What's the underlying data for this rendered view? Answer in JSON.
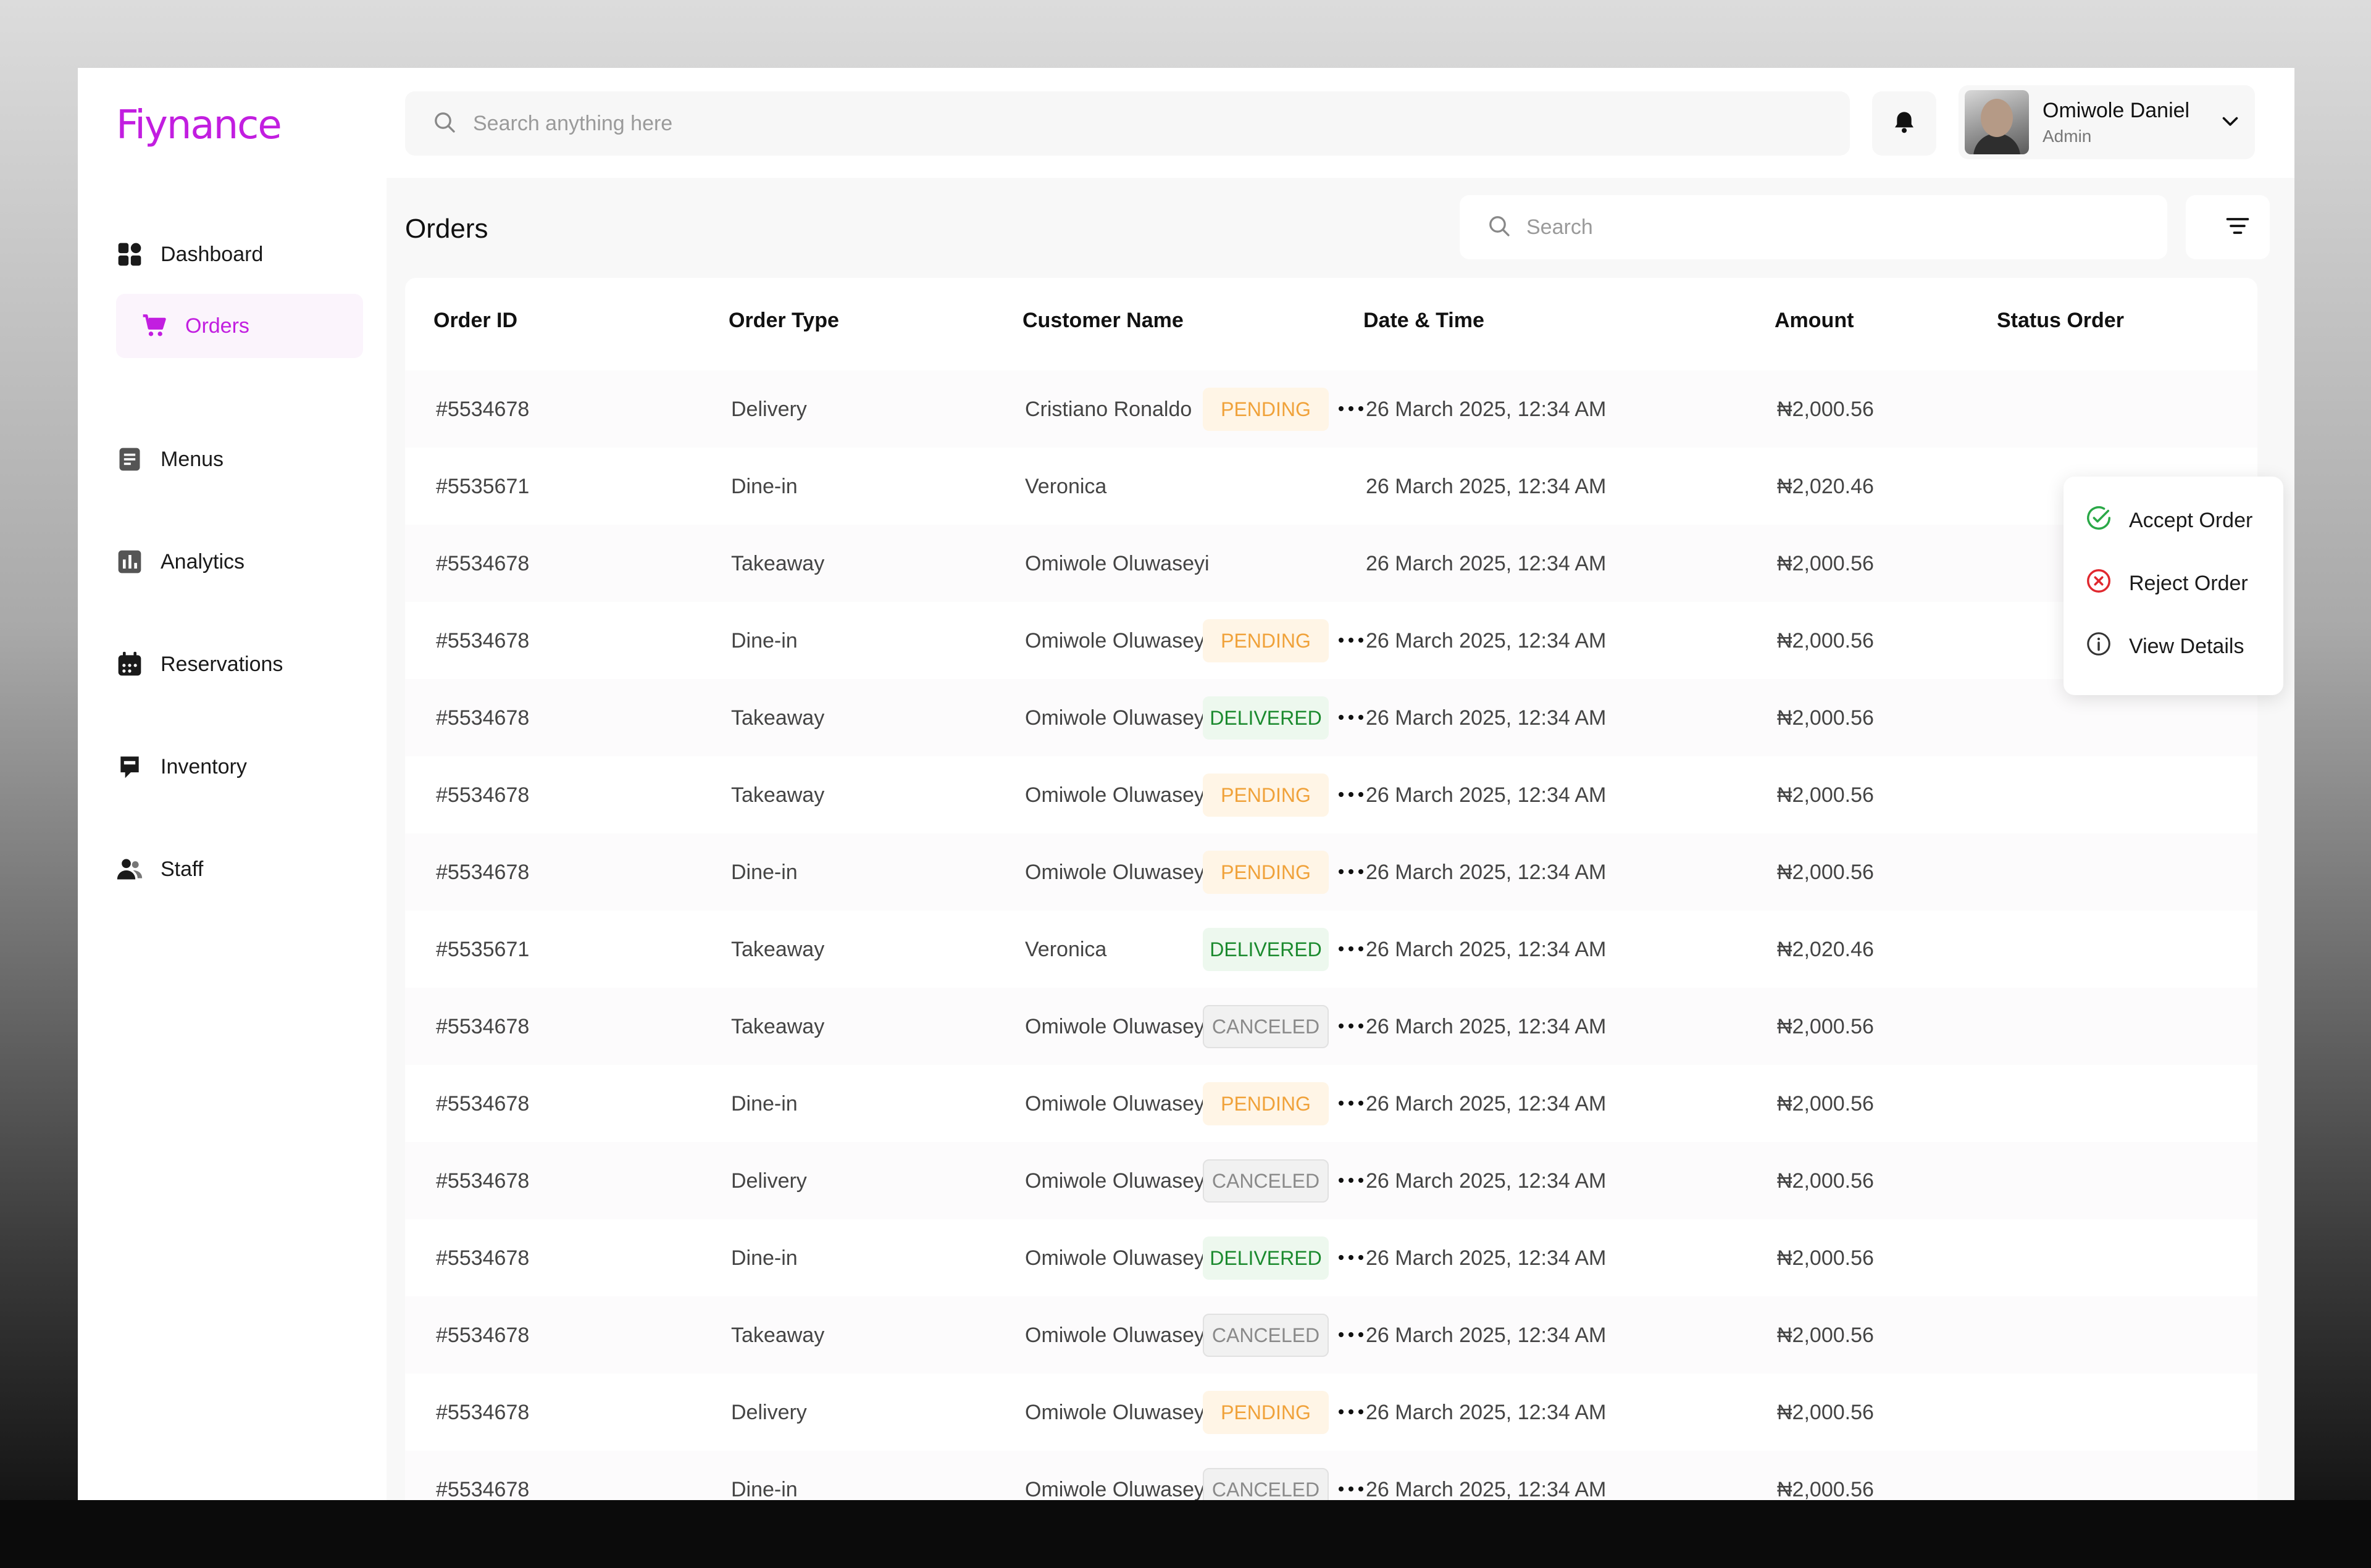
{
  "brand": {
    "logo": "Fiynance",
    "accent": "#c21ee0"
  },
  "sidebar": {
    "items": [
      {
        "label": "Dashboard",
        "icon": "dashboard-grid-icon",
        "active": false
      },
      {
        "label": "Orders",
        "icon": "cart-icon",
        "active": true
      },
      {
        "label": "Menus",
        "icon": "menu-doc-icon",
        "active": false
      },
      {
        "label": "Analytics",
        "icon": "bar-chart-icon",
        "active": false
      },
      {
        "label": "Reservations",
        "icon": "calendar-icon",
        "active": false
      },
      {
        "label": "Inventory",
        "icon": "inventory-icon",
        "active": false
      },
      {
        "label": "Staff",
        "icon": "users-icon",
        "active": false
      }
    ]
  },
  "topbar": {
    "search_placeholder": "Search anything here",
    "user": {
      "name": "Omiwole Daniel",
      "role": "Admin"
    }
  },
  "main": {
    "title": "Orders",
    "search_placeholder": "Search",
    "columns": [
      "Order ID",
      "Order Type",
      "Customer Name",
      "Date & Time",
      "Amount",
      "Status Order"
    ],
    "rows": [
      {
        "id": "#5534678",
        "type": "Delivery",
        "customer": "Cristiano Ronaldo",
        "datetime": "26 March 2025, 12:34 AM",
        "amount": "₦2,000.56",
        "status": "PENDING"
      },
      {
        "id": "#5535671",
        "type": "Dine-in",
        "customer": "Veronica",
        "datetime": "26 March 2025, 12:34 AM",
        "amount": "₦2,020.46",
        "status": ""
      },
      {
        "id": "#5534678",
        "type": "Takeaway",
        "customer": "Omiwole Oluwaseyi",
        "datetime": "26 March 2025, 12:34 AM",
        "amount": "₦2,000.56",
        "status": ""
      },
      {
        "id": "#5534678",
        "type": "Dine-in",
        "customer": "Omiwole Oluwaseyi",
        "datetime": "26 March 2025, 12:34 AM",
        "amount": "₦2,000.56",
        "status": "PENDING"
      },
      {
        "id": "#5534678",
        "type": "Takeaway",
        "customer": "Omiwole Oluwaseyi",
        "datetime": "26 March 2025, 12:34 AM",
        "amount": "₦2,000.56",
        "status": "DELIVERED"
      },
      {
        "id": "#5534678",
        "type": "Takeaway",
        "customer": "Omiwole Oluwaseyi",
        "datetime": "26 March 2025, 12:34 AM",
        "amount": "₦2,000.56",
        "status": "PENDING"
      },
      {
        "id": "#5534678",
        "type": "Dine-in",
        "customer": "Omiwole Oluwaseyi",
        "datetime": "26 March 2025, 12:34 AM",
        "amount": "₦2,000.56",
        "status": "PENDING"
      },
      {
        "id": "#5535671",
        "type": "Takeaway",
        "customer": "Veronica",
        "datetime": "26 March 2025, 12:34 AM",
        "amount": "₦2,020.46",
        "status": "DELIVERED"
      },
      {
        "id": "#5534678",
        "type": "Takeaway",
        "customer": "Omiwole Oluwaseyi",
        "datetime": "26 March 2025, 12:34 AM",
        "amount": "₦2,000.56",
        "status": "CANCELED"
      },
      {
        "id": "#5534678",
        "type": "Dine-in",
        "customer": "Omiwole Oluwaseyi",
        "datetime": "26 March 2025, 12:34 AM",
        "amount": "₦2,000.56",
        "status": "PENDING"
      },
      {
        "id": "#5534678",
        "type": "Delivery",
        "customer": "Omiwole Oluwaseyi",
        "datetime": "26 March 2025, 12:34 AM",
        "amount": "₦2,000.56",
        "status": "CANCELED"
      },
      {
        "id": "#5534678",
        "type": "Dine-in",
        "customer": "Omiwole Oluwaseyi",
        "datetime": "26 March 2025, 12:34 AM",
        "amount": "₦2,000.56",
        "status": "DELIVERED"
      },
      {
        "id": "#5534678",
        "type": "Takeaway",
        "customer": "Omiwole Oluwaseyi",
        "datetime": "26 March 2025, 12:34 AM",
        "amount": "₦2,000.56",
        "status": "CANCELED"
      },
      {
        "id": "#5534678",
        "type": "Delivery",
        "customer": "Omiwole Oluwaseyi",
        "datetime": "26 March 2025, 12:34 AM",
        "amount": "₦2,000.56",
        "status": "PENDING"
      },
      {
        "id": "#5534678",
        "type": "Dine-in",
        "customer": "Omiwole Oluwaseyi",
        "datetime": "26 March 2025, 12:34 AM",
        "amount": "₦2,000.56",
        "status": "CANCELED"
      }
    ]
  },
  "dropdown": {
    "items": [
      {
        "label": "Accept Order",
        "icon": "check-circle-icon",
        "color": "#2aa847"
      },
      {
        "label": "Reject Order",
        "icon": "x-circle-icon",
        "color": "#e0282e"
      },
      {
        "label": "View Details",
        "icon": "info-circle-icon",
        "color": "#333333"
      }
    ]
  },
  "status_colors": {
    "PENDING": "#f0a23a",
    "DELIVERED": "#1b8a2e",
    "CANCELED": "#8a8a8a"
  }
}
